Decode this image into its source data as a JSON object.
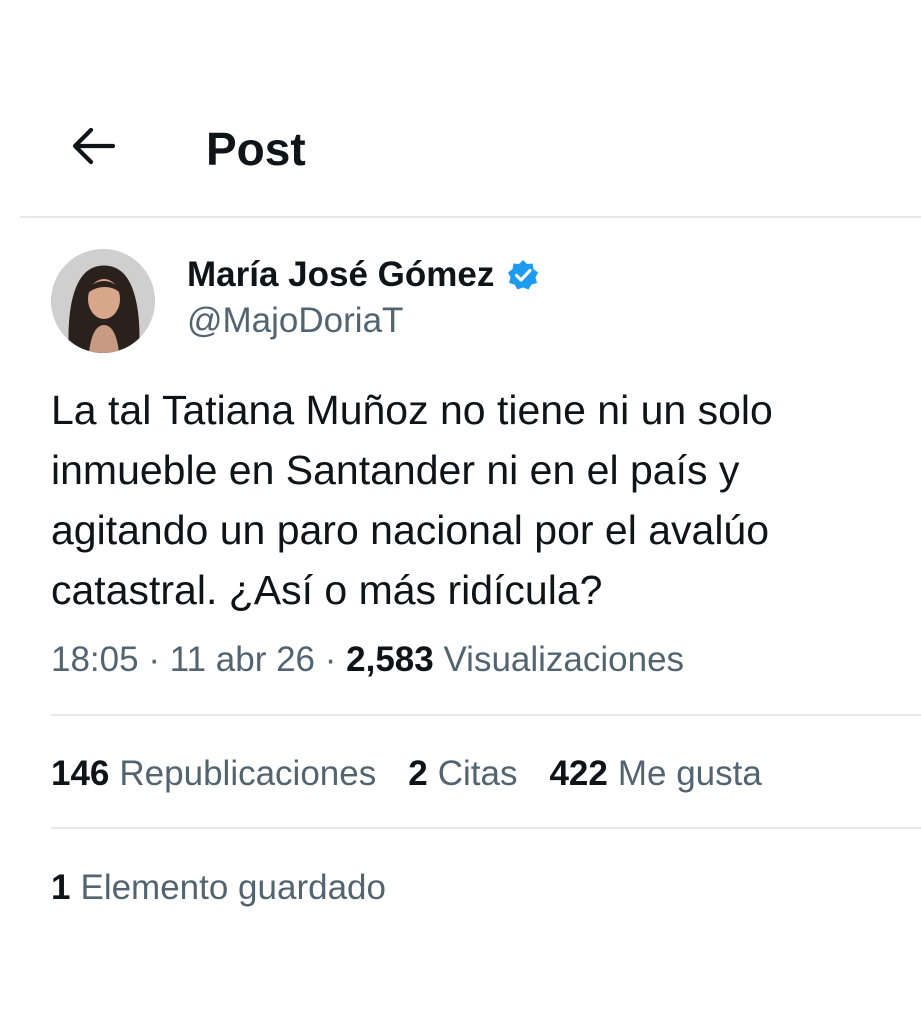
{
  "header": {
    "back_icon": "arrow-left-icon",
    "title": "Post"
  },
  "author": {
    "name": "María José Gómez",
    "handle": "@MajoDoriaT",
    "verified_icon": "verified-badge-icon",
    "verified_color": "#1d9bf0"
  },
  "post": {
    "text": "La tal Tatiana Muñoz no tiene ni un solo\ninmueble en Santander ni en el país y\nagitando un paro nacional por el avalúo\ncatastral. ¿Así o más ridícula?",
    "time": "18:05",
    "separator1": " · ",
    "date": "11 abr 26",
    "separator2": " · ",
    "views_count": "2,583",
    "views_label": "Visualizaciones"
  },
  "stats": [
    {
      "count": "146",
      "label": "Republicaciones"
    },
    {
      "count": "2",
      "label": "Citas"
    },
    {
      "count": "422",
      "label": "Me gusta"
    }
  ],
  "bookmarks": {
    "count": "1",
    "label": "Elemento guardado"
  },
  "colors": {
    "text_primary": "#0f1419",
    "text_secondary": "#536471",
    "divider": "#e6e9ec"
  }
}
